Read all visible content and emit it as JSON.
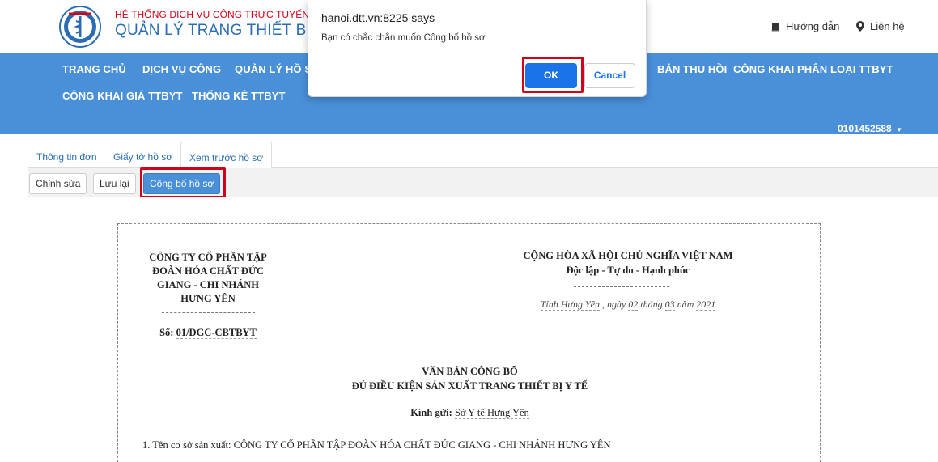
{
  "header": {
    "subtitle": "HỆ THỐNG DỊCH VỤ CÔNG TRỰC TUYẾN",
    "title": "QUẢN LÝ TRANG THIẾT BỊ Y TẾ",
    "links": [
      {
        "label": "Hướng dẫn",
        "icon": "book-icon"
      },
      {
        "label": "Liên hệ",
        "icon": "map-marker-icon"
      }
    ],
    "logo_icon": "ministry-of-health-logo"
  },
  "nav": {
    "row1": [
      "TRANG CHỦ",
      "DỊCH VỤ CÔNG",
      "QUẢN LÝ HỒ SƠ",
      "BẢN THU HỒI",
      "CÔNG KHAI PHÂN LOẠI TTBYT"
    ],
    "row2": [
      "CÔNG KHAI GIÁ TTBYT",
      "THỐNG KÊ TTBYT"
    ],
    "user": "0101452588"
  },
  "tabs": [
    "Thông tin đơn",
    "Giấy tờ hồ sơ",
    "Xem trước hồ sơ"
  ],
  "toolbar": {
    "edit": "Chỉnh sửa",
    "save": "Lưu lại",
    "publish": "Công bố hồ sơ"
  },
  "document": {
    "company_lines": [
      "CÔNG TY CỔ PHẦN TẬP",
      "ĐOÀN HÓA CHẤT ĐỨC",
      "GIANG - CHI NHÁNH",
      "HƯNG YÊN"
    ],
    "number_label": "Số:",
    "number_value": "01/DGC-CBTBYT",
    "nation": "CỘNG HÒA XÃ HỘI CHỦ NGHĨA VIỆT NAM",
    "motto": "Độc lập - Tự do - Hạnh phúc",
    "place": "Tỉnh Hưng Yên",
    "date_prefix": ", ngày",
    "day": "02",
    "month_label": "tháng",
    "month": "03",
    "year_label": "năm",
    "year": "2021",
    "doc_title": "VĂN BẢN CÔNG BỐ",
    "doc_subtitle": "ĐỦ ĐIỀU KIỆN SẢN XUẤT TRANG THIẾT BỊ Y TẾ",
    "recipient_label": "Kính gửi:",
    "recipient": "Sở Y tế Hưng Yên",
    "item1_label": "1. Tên cơ sở sản xuất:",
    "item1_value": "CÔNG TY CỔ PHẦN TẬP ĐOÀN HÓA CHẤT ĐỨC GIANG - CHI NHÁNH HƯNG YÊN"
  },
  "dialog": {
    "title": "hanoi.dtt.vn:8225 says",
    "message": "Bạn có chắc chắn muốn Công bố hồ sơ",
    "ok": "OK",
    "cancel": "Cancel"
  },
  "colors": {
    "navbar": "#4a90d9",
    "brand_blue": "#2a6db5",
    "brand_red": "#d0021b",
    "highlight": "#d0021b",
    "dialog_button": "#1a73e8"
  }
}
